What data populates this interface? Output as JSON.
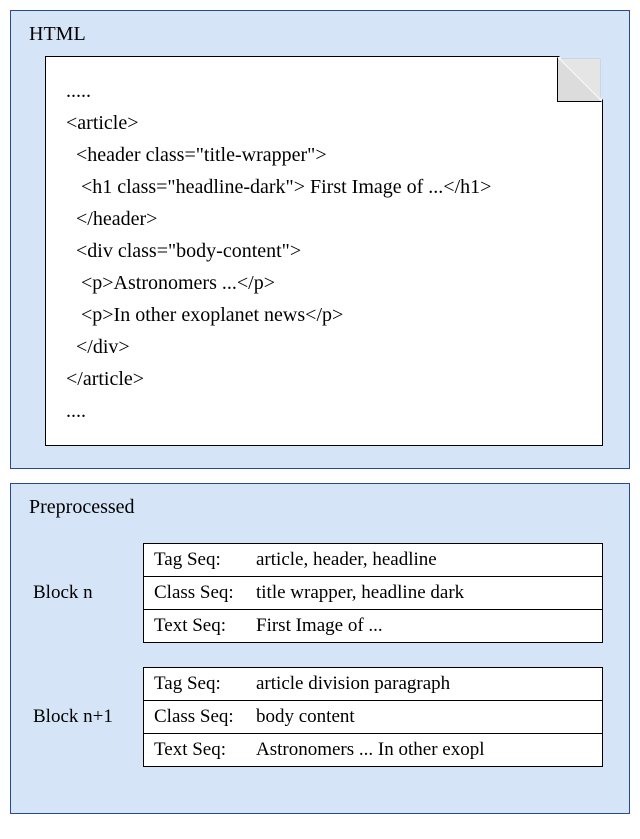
{
  "top": {
    "title": "HTML",
    "code_lines": [
      ".....",
      "<article>",
      "  <header class=\"title-wrapper\">",
      "   <h1 class=\"headline-dark\"> First Image of ...</h1>",
      "  </header>",
      "  <div class=\"body-content\">",
      "   <p>Astronomers ...</p>",
      "   <p>In other exoplanet news</p>",
      "  </div>",
      "</article>",
      "...."
    ]
  },
  "bottom": {
    "title": "Preprocessed",
    "blocks": [
      {
        "label": "Block n",
        "rows": [
          {
            "k": "Tag Seq:",
            "v": "article, header, headline"
          },
          {
            "k": "Class Seq:",
            "v": "title wrapper, headline dark"
          },
          {
            "k": "Text Seq:",
            "v": "First Image of ..."
          }
        ]
      },
      {
        "label": "Block n+1",
        "rows": [
          {
            "k": "Tag Seq:",
            "v": "article division paragraph"
          },
          {
            "k": "Class Seq:",
            "v": "body content"
          },
          {
            "k": "Text Seq:",
            "v": "Astronomers ... In other exopl"
          }
        ]
      }
    ]
  }
}
